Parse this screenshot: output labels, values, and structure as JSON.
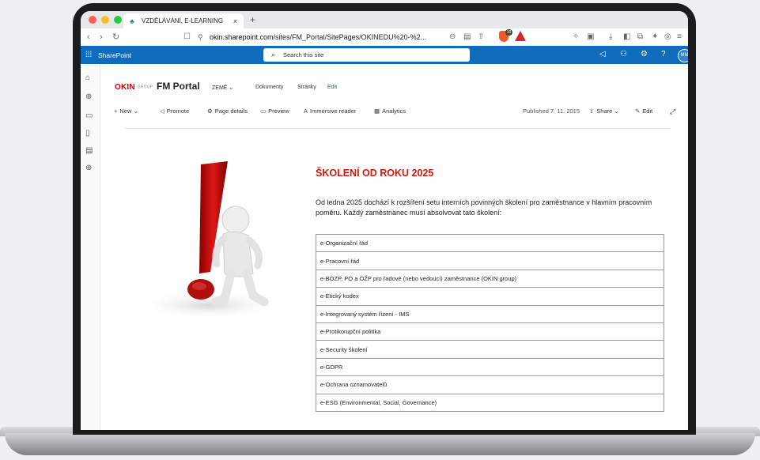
{
  "browser": {
    "tab_title": "VZDĚLÁVÁNÍ, E-LEARNING",
    "tab_close": "×",
    "new_tab": "+",
    "url_prefix": "okin.sharepoint.com",
    "url_rest": "/sites/FM_Portal/SitePages/OKINEDU%20-%2...",
    "brave_badge": "10"
  },
  "sharepoint": {
    "app_name": "SharePoint",
    "search_placeholder": "Search this site",
    "avatar_initials": "MM"
  },
  "site": {
    "logo_text": "OKIN",
    "logo_sub": "GROUP",
    "name": "FM Portal",
    "nav": [
      {
        "label": "ZEMĚ ⌄"
      },
      {
        "label": "Dokumenty"
      },
      {
        "label": "Stránky"
      },
      {
        "label": "Edit"
      }
    ]
  },
  "command_bar": {
    "new": "New",
    "promote": "Promote",
    "page_details": "Page details",
    "preview": "Preview",
    "immersive_reader": "Immersive reader",
    "analytics": "Analytics",
    "published": "Published 7. 11. 2015",
    "share": "Share",
    "edit": "Edit"
  },
  "content": {
    "heading": "ŠKOLENÍ OD ROKU 2025",
    "paragraph": "Od ledna 2025 dochází k rozšíření setu interních povinných školení pro zaměstnance v hlavním pracovním poměru. Každý zaměstnanec musí absolvovat tato školení:",
    "trainings": [
      "e-Organizační řád",
      "e-Pracovní řád",
      "e-BOZP, PO a OŽP pro řadové (nebo vedoucí) zaměstnance (OKIN group)",
      "e-Etický kodex",
      "e-Integrovaný systém řízení - IMS",
      "e-Protikorupční politika",
      "e-Security školení",
      "e-GDPR",
      "e-Ochrana oznamovatelů",
      "e-ESG (Environmental, Social, Governance)"
    ]
  },
  "colors": {
    "sharepoint_blue": "#0f6cbd",
    "heading_red": "#d1180b"
  }
}
